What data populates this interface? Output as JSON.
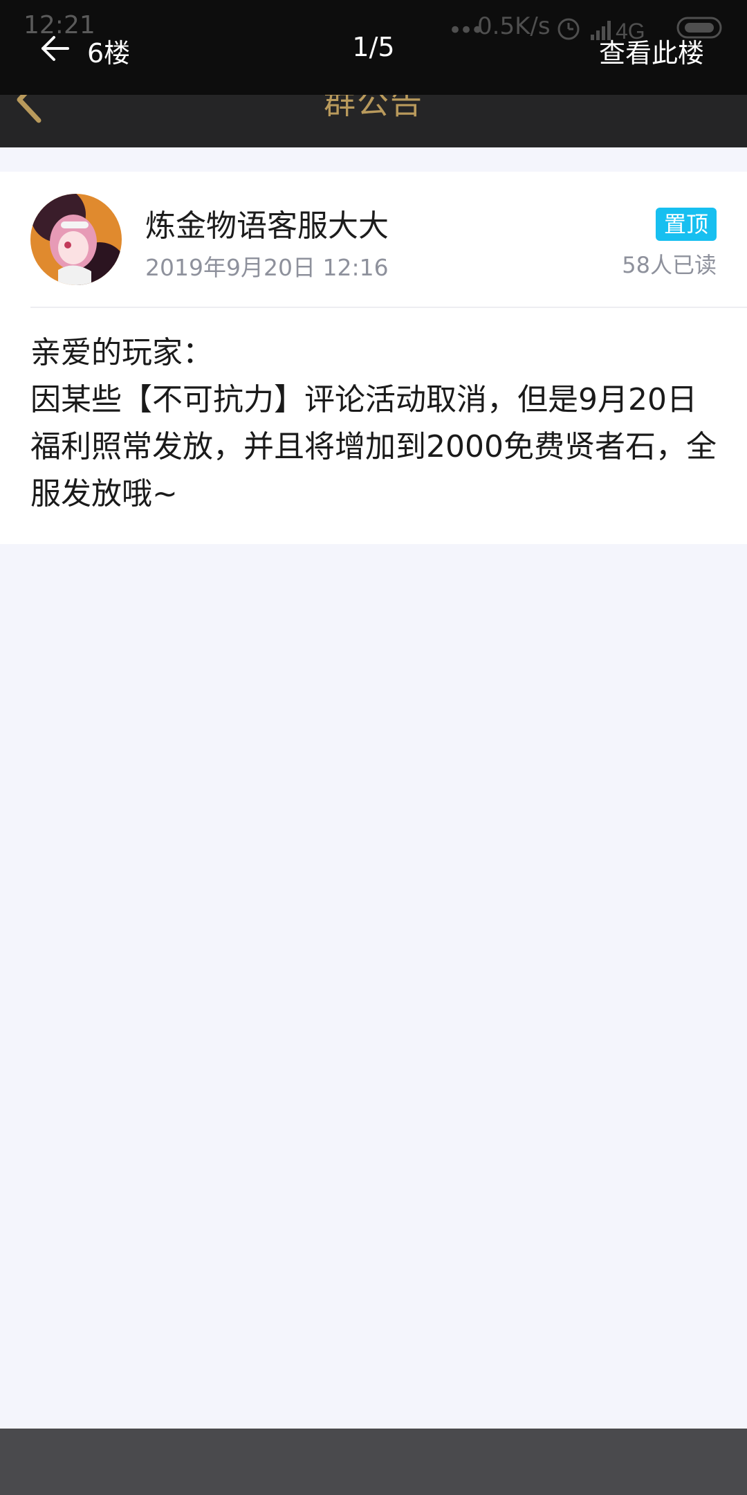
{
  "status_bar": {
    "time": "12:21",
    "network_speed": "0.5K/s",
    "network_type": "4G"
  },
  "app_header": {
    "title": "群公告"
  },
  "viewer_bar": {
    "floor": "6楼",
    "page": "1/5",
    "view_floor": "查看此楼"
  },
  "post": {
    "author": "炼金物语客服大大",
    "timestamp": "2019年9月20日 12:16",
    "badge": "置顶",
    "read_count": "58人已读",
    "greeting": "亲爱的玩家：",
    "body": "因某些【不可抗力】评论活动取消，但是9月20日福利照常发放，并且将增加到2000免费贤者石，全服发放哦~"
  },
  "colors": {
    "accent_gold": "#b99a5c",
    "badge_blue": "#17bff0",
    "page_bg": "#f4f5fc"
  },
  "icons": {
    "app_back": "chevron-left-icon",
    "viewer_back": "arrow-left-icon",
    "alarm": "alarm-icon",
    "signal": "signal-icon",
    "battery": "battery-icon"
  }
}
